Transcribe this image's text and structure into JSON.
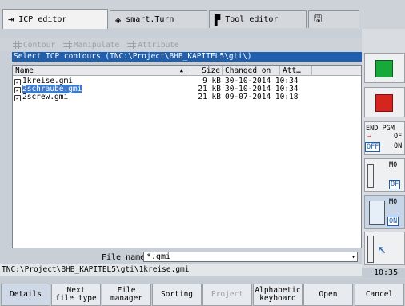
{
  "tabs": [
    {
      "label": "ICP editor",
      "icon": "arrow-to-bar-icon"
    },
    {
      "label": "smart.Turn",
      "icon": "diamond-arrows-icon"
    },
    {
      "label": "Tool editor",
      "icon": "tool-icon"
    },
    {
      "label": "",
      "icon": "save-icon"
    }
  ],
  "menu": {
    "items": [
      "Contour",
      "Manipulate",
      "Attribute"
    ]
  },
  "dialog": {
    "title": "Select ICP contours  (TNC:\\Project\\BHB_KAPITEL5\\gti\\)",
    "columns": [
      "Name",
      "Size",
      "Changed on",
      "Att…"
    ],
    "rows": [
      {
        "name": "1kreise.gmi",
        "size": "9 kB",
        "changed": "30-10-2014 10:34",
        "selected": false
      },
      {
        "name": "2schraube.gmi",
        "size": "21 kB",
        "changed": "30-10-2014 10:34",
        "selected": true
      },
      {
        "name": "2screw.gmi",
        "size": "21 kB",
        "changed": "09-07-2014 10:18",
        "selected": false
      }
    ],
    "file_name_label": "File name:",
    "file_name_value": "*.gmi"
  },
  "status": {
    "path": "TNC:\\Project\\BHB_KAPITEL5\\gti\\1kreise.gmi",
    "clock": "10:35"
  },
  "side": {
    "end_pgm_label": "END PGM",
    "off_label": "OFF",
    "on_label": "ON",
    "m0_label": "M0",
    "off_short": "OF",
    "colors": {
      "green": "#19a83a",
      "red": "#d8241e",
      "blue": "#1f5fae"
    }
  },
  "softkeys": [
    {
      "label": "Details",
      "state": "active"
    },
    {
      "label": "Next\nfile type",
      "state": "normal"
    },
    {
      "label": "File\nmanager",
      "state": "normal"
    },
    {
      "label": "Sorting",
      "state": "normal"
    },
    {
      "label": "Project",
      "state": "disabled"
    },
    {
      "label": "Alphabetic\nkeyboard",
      "state": "normal"
    },
    {
      "label": "Open",
      "state": "normal"
    },
    {
      "label": "Cancel",
      "state": "normal"
    }
  ]
}
